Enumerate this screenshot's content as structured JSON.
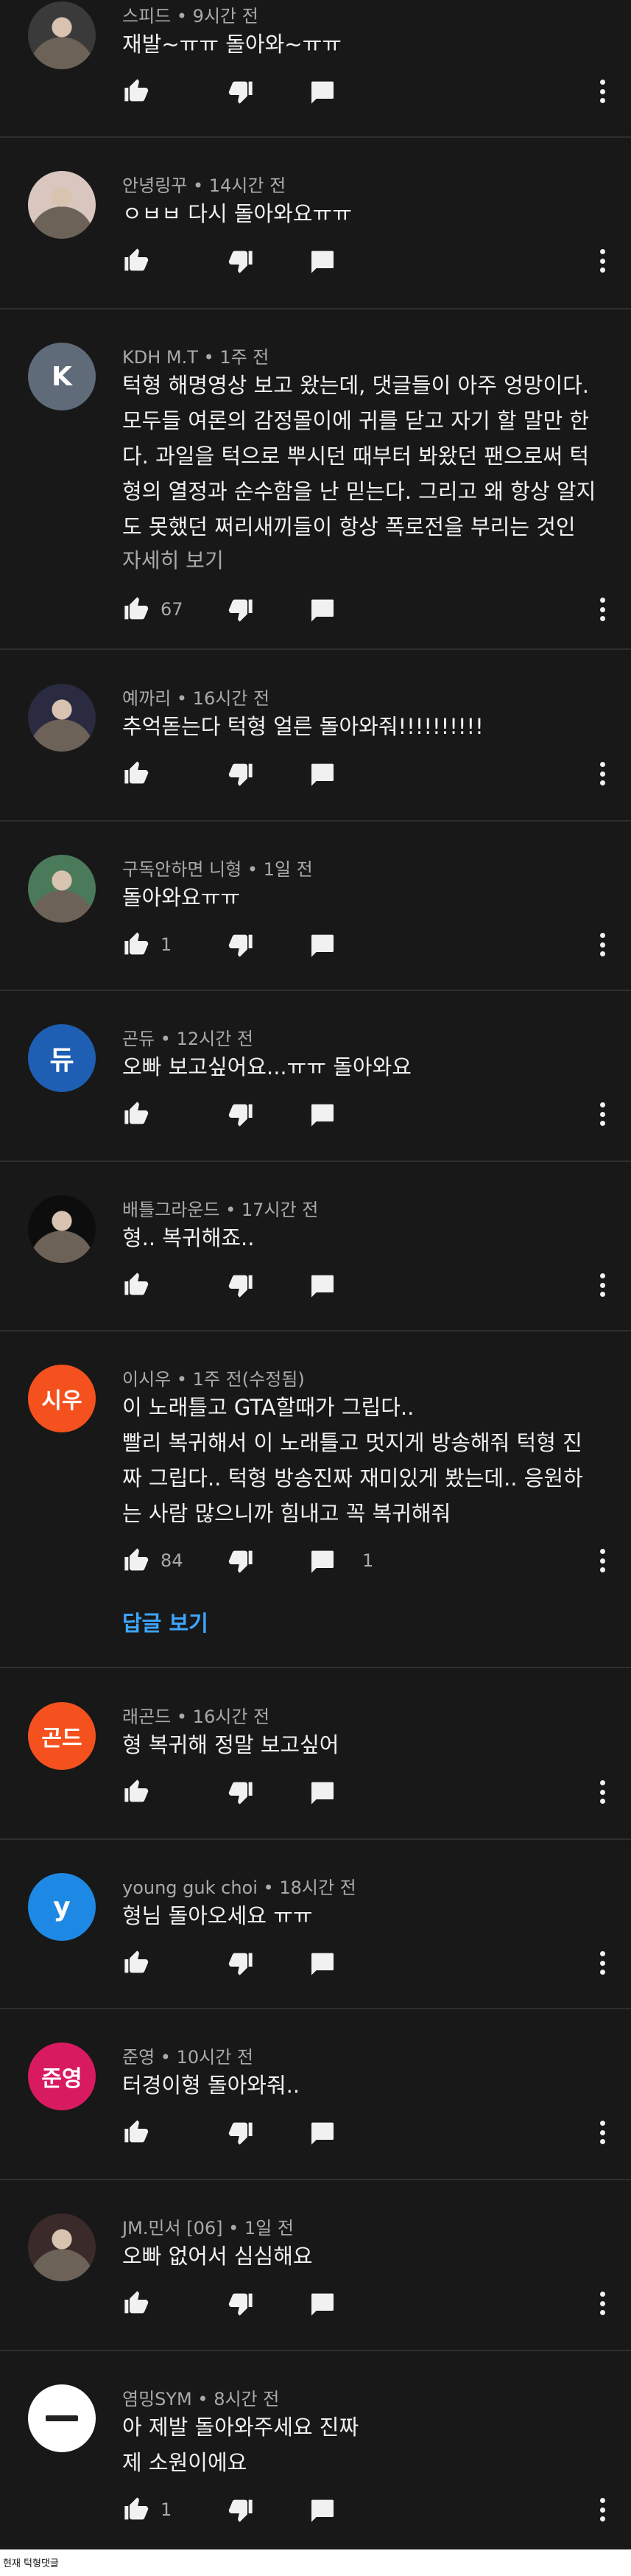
{
  "comments": [
    {
      "author": "스피드",
      "time": "9시간 전",
      "lines": [
        "재발~ㅠㅠ 돌아와~ㅠㅠ"
      ],
      "likes": "",
      "replies": "",
      "avatar": {
        "text": "",
        "color": "#3a3a3a"
      }
    },
    {
      "author": "안녕링꾸",
      "time": "14시간 전",
      "lines": [
        "ㅇㅂㅂ 다시 돌아와요ㅠㅠ"
      ],
      "likes": "",
      "replies": "",
      "avatar": {
        "text": "",
        "color": "#d9c7bf"
      }
    },
    {
      "author": "KDH M.T",
      "time": "1주 전",
      "lines": [
        "턱형 해명영상 보고 왔는데, 댓글들이 아주 엉망이다.",
        "모두들 여론의 감정몰이에 귀를 닫고 자기 할 말만 한",
        "다. 과일을 턱으로 뿌시던 때부터 봐왔던 팬으로써 턱",
        "형의 열정과 순수함을 난 믿는다. 그리고 왜 항상 알지",
        "도 못했던 쩌리새끼들이 항상 폭로전을 부리는 것인"
      ],
      "more": "자세히 보기",
      "likes": "67",
      "replies": "",
      "avatar": {
        "text": "K",
        "color": "#5f6b78"
      }
    },
    {
      "author": "예까리",
      "time": "16시간 전",
      "lines": [
        "추억돋는다 턱형 얼른 돌아와줘!!!!!!!!!!"
      ],
      "likes": "",
      "replies": "",
      "avatar": {
        "text": "",
        "color": "#2a2a40"
      }
    },
    {
      "author": "구독안하면 니형",
      "time": "1일 전",
      "lines": [
        "돌아와요ㅠㅠ"
      ],
      "likes": "1",
      "replies": "",
      "avatar": {
        "text": "",
        "color": "#4a7a5a"
      }
    },
    {
      "author": "곤듀",
      "time": "12시간 전",
      "lines": [
        "오빠 보고싶어요...ㅠㅠ 돌아와요"
      ],
      "likes": "",
      "replies": "",
      "avatar": {
        "text": "듀",
        "color": "#1e5fb4"
      }
    },
    {
      "author": "배틀그라운드",
      "time": "17시간 전",
      "lines": [
        "형.. 복귀해죠.."
      ],
      "likes": "",
      "replies": "",
      "avatar": {
        "text": "",
        "color": "#0d0d0d"
      }
    },
    {
      "author": "이시우",
      "time": "1주 전(수정됨)",
      "lines": [
        "이 노래틀고 GTA할때가 그립다..",
        "빨리 복귀해서 이 노래틀고 멋지게 방송해줘 턱형 진",
        "짜 그립다.. 턱형 방송진짜 재미있게 봤는데.. 응원하",
        "는 사람 많으니까 힘내고 꼭 복귀해줘"
      ],
      "likes": "84",
      "replies": "1",
      "view_replies": "답글 보기",
      "avatar": {
        "text": "시우",
        "color": "#f4511e"
      }
    },
    {
      "author": "래곤드",
      "time": "16시간 전",
      "lines": [
        "형 복귀해 정말 보고싶어"
      ],
      "likes": "",
      "replies": "",
      "avatar": {
        "text": "곤드",
        "color": "#f4511e"
      }
    },
    {
      "author": "young guk choi",
      "time": "18시간 전",
      "lines": [
        "형님 돌아오세요 ㅠㅠ"
      ],
      "likes": "",
      "replies": "",
      "avatar": {
        "text": "y",
        "color": "#1e88e5"
      }
    },
    {
      "author": "준영",
      "time": "10시간 전",
      "lines": [
        "터경이형 돌아와줘.."
      ],
      "likes": "",
      "replies": "",
      "avatar": {
        "text": "준영",
        "color": "#d81b60"
      }
    },
    {
      "author": "JM.민서 [06]",
      "time": "1일 전",
      "lines": [
        "오빠 없어서 심심해요"
      ],
      "likes": "",
      "replies": "",
      "avatar": {
        "text": "",
        "color": "#3a2a2a"
      }
    },
    {
      "author": "염밍SYM",
      "time": "8시간 전",
      "lines": [
        "아 제발 돌아와주세요 진짜",
        "제 소원이에요"
      ],
      "likes": "1",
      "replies": "",
      "avatar": {
        "text": "",
        "color": "#ffffff"
      }
    }
  ],
  "icons": {
    "like": "thumb-up-icon",
    "dislike": "thumb-down-icon",
    "reply": "comment-reply-icon",
    "menu": "more-vertical-icon"
  },
  "caption": "현재 턱형댓글"
}
